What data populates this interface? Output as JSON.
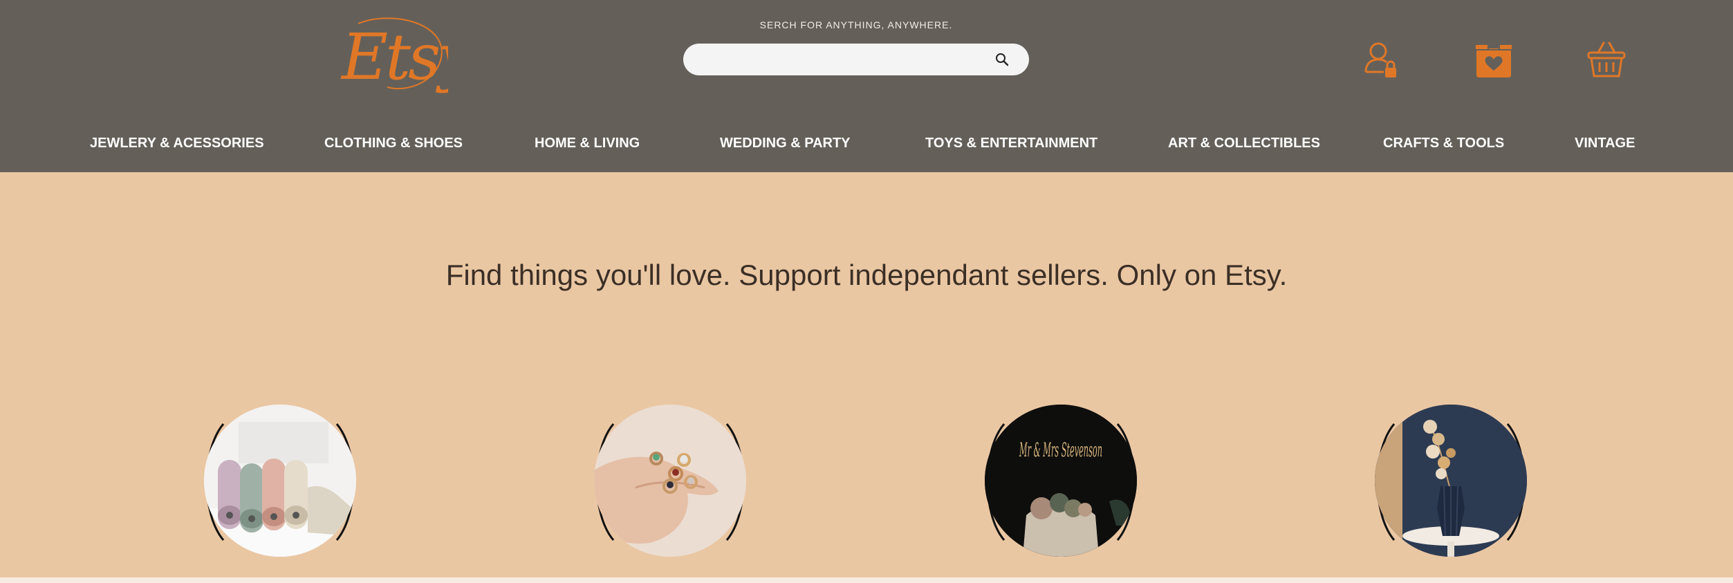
{
  "header": {
    "logo_text": "Etsy",
    "search_caption": "SERCH FOR ANYTHING, ANYWHERE.",
    "search_placeholder": "",
    "icons": [
      "account-icon",
      "shop-box-icon",
      "basket-icon"
    ],
    "accent_color": "#e07727",
    "background_color": "#646059"
  },
  "nav": {
    "items": [
      {
        "label": "JEWLERY & ACESSORIES"
      },
      {
        "label": "CLOTHING & SHOES"
      },
      {
        "label": "HOME & LIVING"
      },
      {
        "label": "WEDDING & PARTY"
      },
      {
        "label": "TOYS & ENTERTAINMENT"
      },
      {
        "label": "ART & COLLECTIBLES"
      },
      {
        "label": "CRAFTS & TOOLS"
      },
      {
        "label": "VINTAGE"
      }
    ]
  },
  "main": {
    "headline": "Find things you'll love. Support independant sellers. Only on Etsy.",
    "background_color": "#eac7a3",
    "categories": [
      {
        "image": "rolled-fabrics"
      },
      {
        "image": "hand-with-rings"
      },
      {
        "image": "wedding-cake-topper",
        "topper_text": "Mr & Mrs Stevenson"
      },
      {
        "image": "vase-with-dried-flowers"
      }
    ]
  }
}
